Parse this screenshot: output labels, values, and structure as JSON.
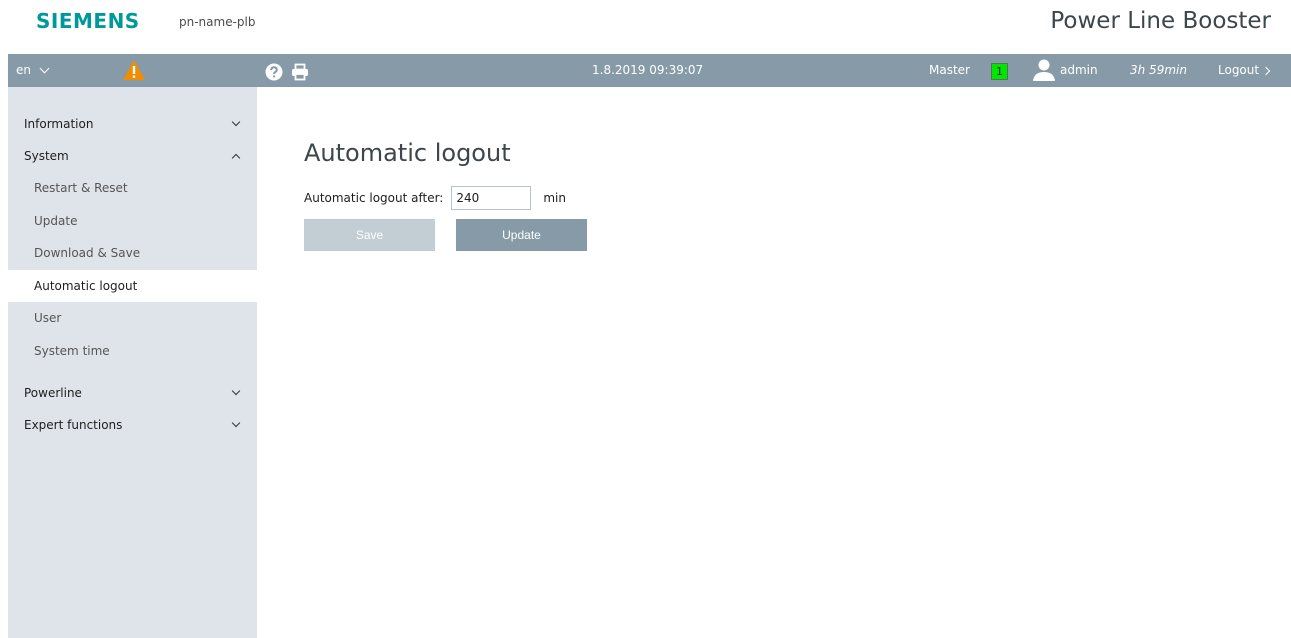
{
  "header": {
    "logo": "SIEMENS",
    "device_name": "pn-name-plb",
    "product_name": "Power Line Booster"
  },
  "topbar": {
    "language": "en",
    "datetime": "1.8.2019 09:39:07",
    "mode": "Master",
    "master_number": "1",
    "username": "admin",
    "session_time": "3h 59min",
    "logout_label": "Logout",
    "colors": {
      "bar": "#879aa8",
      "warning": "#f28c00",
      "status_ok": "#00e600"
    }
  },
  "sidebar": {
    "groups": [
      {
        "label": "Information",
        "expanded": false
      },
      {
        "label": "System",
        "expanded": true,
        "items": [
          "Restart & Reset",
          "Update",
          "Download & Save",
          "Automatic logout",
          "User",
          "System time"
        ],
        "active": "Automatic logout"
      },
      {
        "label": "Powerline",
        "expanded": false
      },
      {
        "label": "Expert functions",
        "expanded": false
      }
    ]
  },
  "main": {
    "title": "Automatic logout",
    "field_label": "Automatic logout after:",
    "field_value": "240",
    "field_unit": "min",
    "save_label": "Save",
    "update_label": "Update"
  },
  "icons": [
    "warning-icon",
    "help-icon",
    "print-icon",
    "user-icon",
    "chevron-down-icon",
    "chevron-up-icon",
    "chevron-right-icon"
  ]
}
